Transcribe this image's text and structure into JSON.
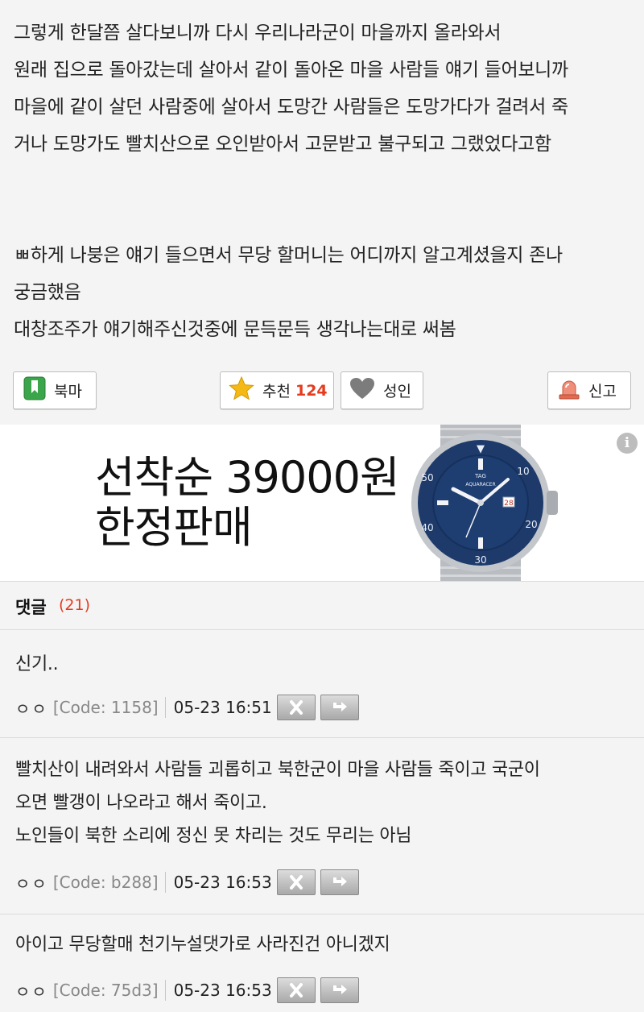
{
  "article": {
    "lines": [
      "그렇게 한달쯤 살다보니까 다시 우리나라군이 마을까지 올라와서",
      "원래 집으로 돌아갔는데 살아서 같이 돌아온 마을 사람들 얘기 들어보니까",
      "마을에 같이 살던 사람중에 살아서 도망간 사람들은 도망가다가 걸려서 죽",
      "거나 도망가도 빨치산으로 오인받아서 고문받고 불구되고 그랬었다고함",
      "ㅃ하게 나붕은 얘기 들으면서 무당 할머니는 어디까지 알고계셨을지 존나",
      "궁금했음",
      "대창조주가 얘기해주신것중에 문득문득 생각나는대로 써봄"
    ]
  },
  "actions": {
    "bookmark_label": "북마",
    "recommend_label": "추천",
    "recommend_count": "124",
    "adult_label": "성인",
    "report_label": "신고"
  },
  "ad": {
    "line1": "선착순 39000원",
    "line2": "한정판매",
    "info_glyph": "i",
    "watch_brand": "TAG",
    "watch_model": "AQUARACER"
  },
  "comments_header": {
    "label": "댓글",
    "count": "(21)"
  },
  "comments": [
    {
      "lines": [
        "신기.."
      ],
      "nick": "ㅇㅇ",
      "code": "[Code: 1158]",
      "date": "05-23 16:51"
    },
    {
      "lines": [
        "빨치산이 내려와서 사람들 괴롭히고 북한군이 마을 사람들 죽이고 국군이",
        "오면 빨갱이 나오라고 해서 죽이고.",
        "노인들이 북한 소리에 정신 못 차리는 것도 무리는 아님"
      ],
      "nick": "ㅇㅇ",
      "code": "[Code: b288]",
      "date": "05-23 16:53"
    },
    {
      "lines": [
        "아이고 무당할매 천기누설댓가로 사라진건 아니겠지"
      ],
      "nick": "ㅇㅇ",
      "code": "[Code: 75d3]",
      "date": "05-23 16:53"
    }
  ],
  "colors": {
    "accent_red": "#e53b1f",
    "bookmark_green": "#3aa54a",
    "star_yellow": "#f5b915",
    "watch_blue": "#1d3a6b"
  }
}
